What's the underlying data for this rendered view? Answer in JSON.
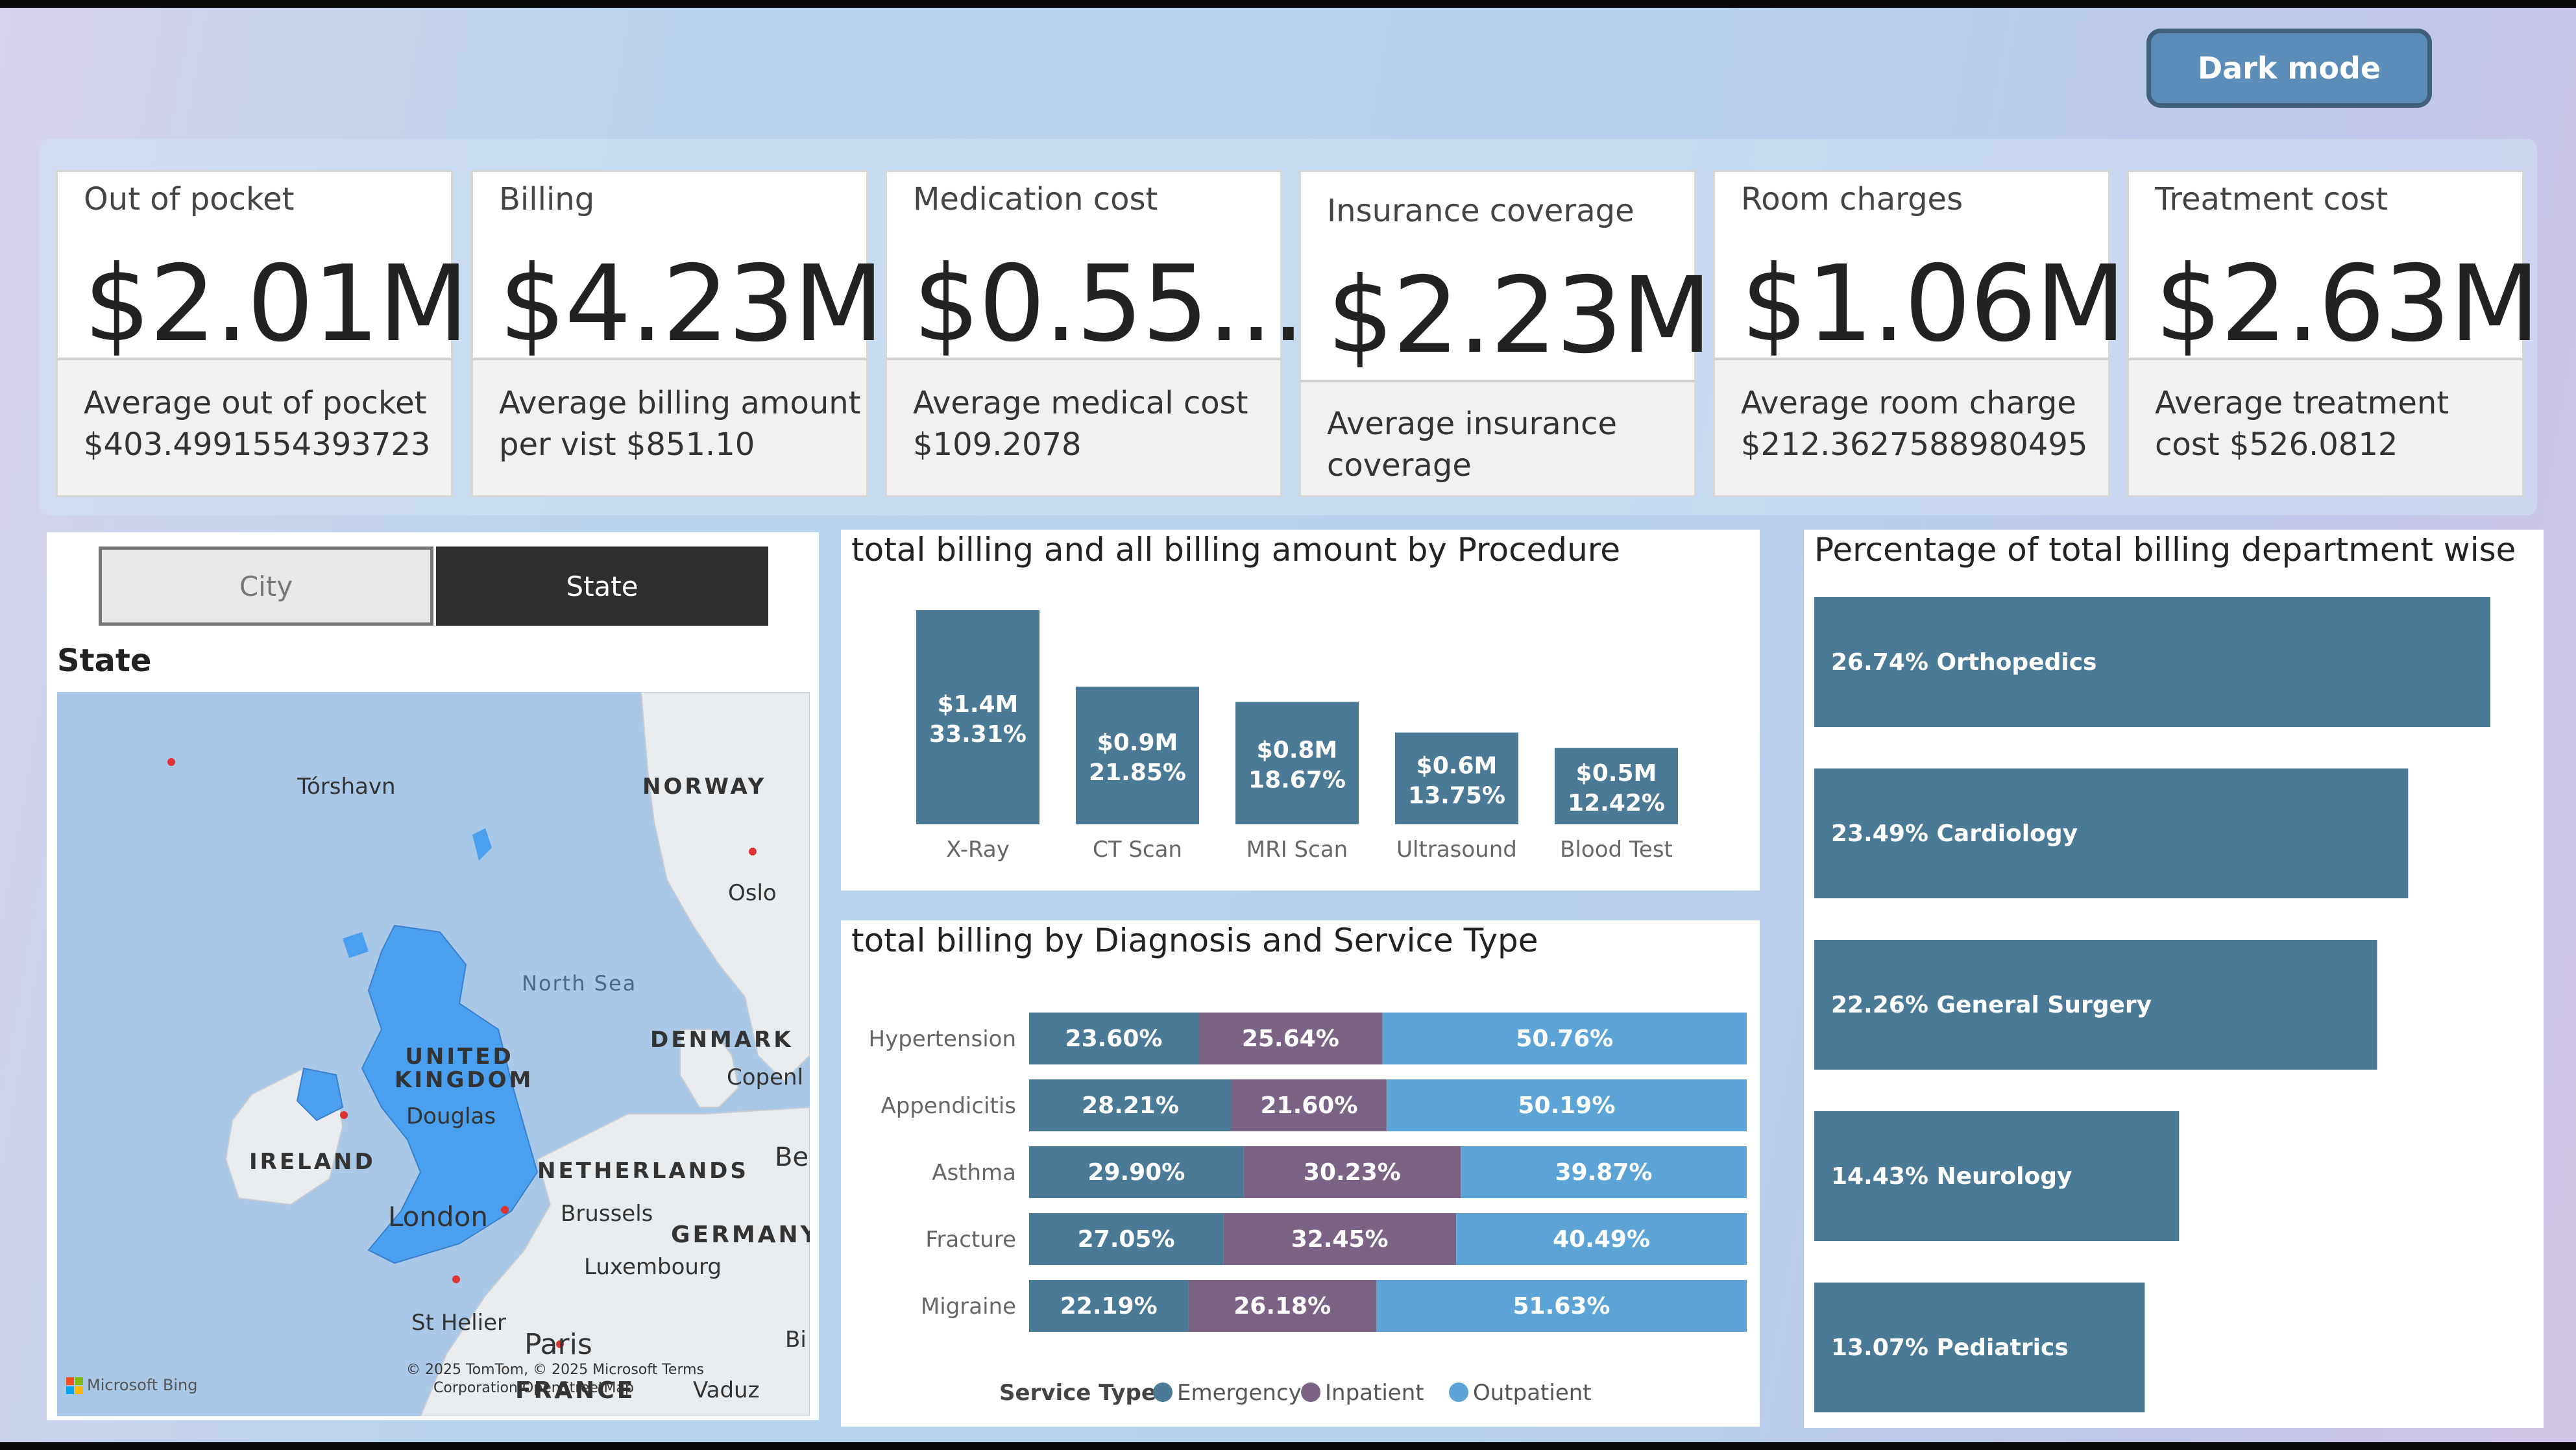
{
  "header": {
    "dark_mode_label": "Dark mode"
  },
  "cards": [
    {
      "label": "Out of pocket",
      "value": "$2.01M",
      "sub": "Average out of pocket $403.4991554393723"
    },
    {
      "label": "Billing",
      "value": "$4.23M",
      "sub": "Average billing amount per vist $851.10"
    },
    {
      "label": "Medication cost",
      "value": "$0.55...",
      "sub": "Average medical cost $109.2078"
    },
    {
      "label": "Insurance coverage",
      "value": "$2.23M",
      "sub": "Average insurance coverage"
    },
    {
      "label": "Room charges",
      "value": "$1.06M",
      "sub": "Average room charge $212.3627588980495"
    },
    {
      "label": "Treatment cost",
      "value": "$2.63M",
      "sub": "Average treatment cost $526.0812"
    }
  ],
  "slicer": {
    "city_label": "City",
    "state_label": "State",
    "map_title": "State"
  },
  "map": {
    "labels": {
      "torshavn": "Tórshavn",
      "norway": "NORWAY",
      "oslo": "Oslo",
      "north_sea": "North Sea",
      "denmark": "DENMARK",
      "copenhagen": "Copenl",
      "uk": "UNITED KINGDOM",
      "douglas": "Douglas",
      "ireland": "IRELAND",
      "netherlands": "NETHERLANDS",
      "be": "Be",
      "london": "London",
      "brussels": "Brussels",
      "germany": "GERMANY",
      "luxembourg": "Luxembourg",
      "st_helier": "St Helier",
      "paris": "Paris",
      "bi": "Bi",
      "france": "FRANCE",
      "vaduz": "Vaduz",
      "bing": "Microsoft Bing",
      "copyright": "© 2025 TomTom, © 2025 Microsoft Terms",
      "corp": "Corporation OpenStreetMap"
    }
  },
  "procedure_chart": {
    "title": "total billing and all billing amount by Procedure",
    "bar_color": "#4a7a96",
    "chart_data": {
      "type": "bar",
      "categories": [
        "X-Ray",
        "CT Scan",
        "MRI Scan",
        "Ultrasound",
        "Blood Test"
      ],
      "values": [
        1.4,
        0.9,
        0.8,
        0.6,
        0.5
      ],
      "value_labels": [
        "$1.4M",
        "$0.9M",
        "$0.8M",
        "$0.6M",
        "$0.5M"
      ],
      "percent_labels": [
        "33.31%",
        "21.85%",
        "18.67%",
        "13.75%",
        "12.42%"
      ],
      "unit": "$M"
    }
  },
  "diagnosis_chart": {
    "title": "total billing by Diagnosis and Service Type",
    "legend_title": "Service Type",
    "chart_data": {
      "type": "bar",
      "stacked": "100%",
      "orientation": "horizontal",
      "categories": [
        "Hypertension",
        "Appendicitis",
        "Asthma",
        "Fracture",
        "Migraine"
      ],
      "series": [
        {
          "name": "Emergency",
          "color": "#4a7a96",
          "values": [
            23.6,
            28.21,
            29.9,
            27.05,
            22.19
          ],
          "labels": [
            "23.60%",
            "28.21%",
            "29.90%",
            "27.05%",
            "22.19%"
          ]
        },
        {
          "name": "Inpatient",
          "color": "#7a6385",
          "values": [
            25.64,
            21.6,
            30.23,
            32.45,
            26.18
          ],
          "labels": [
            "25.64%",
            "21.60%",
            "30.23%",
            "32.45%",
            "26.18%"
          ]
        },
        {
          "name": "Outpatient",
          "color": "#5ca4d6",
          "values": [
            50.76,
            50.19,
            39.87,
            40.49,
            51.63
          ],
          "labels": [
            "50.76%",
            "50.19%",
            "39.87%",
            "40.49%",
            "51.63%"
          ]
        }
      ]
    }
  },
  "department_chart": {
    "title": "Percentage of total billing department wise",
    "bar_color": "#4a7a96",
    "chart_data": {
      "type": "bar",
      "orientation": "horizontal",
      "categories": [
        "Orthopedics",
        "Cardiology",
        "General Surgery",
        "Neurology",
        "Pediatrics"
      ],
      "values": [
        26.74,
        23.49,
        22.26,
        14.43,
        13.07
      ],
      "labels": [
        "26.74% Orthopedics",
        "23.49% Cardiology",
        "22.26% General Surgery",
        "14.43% Neurology",
        "13.07% Pediatrics"
      ],
      "unit": "%"
    }
  }
}
